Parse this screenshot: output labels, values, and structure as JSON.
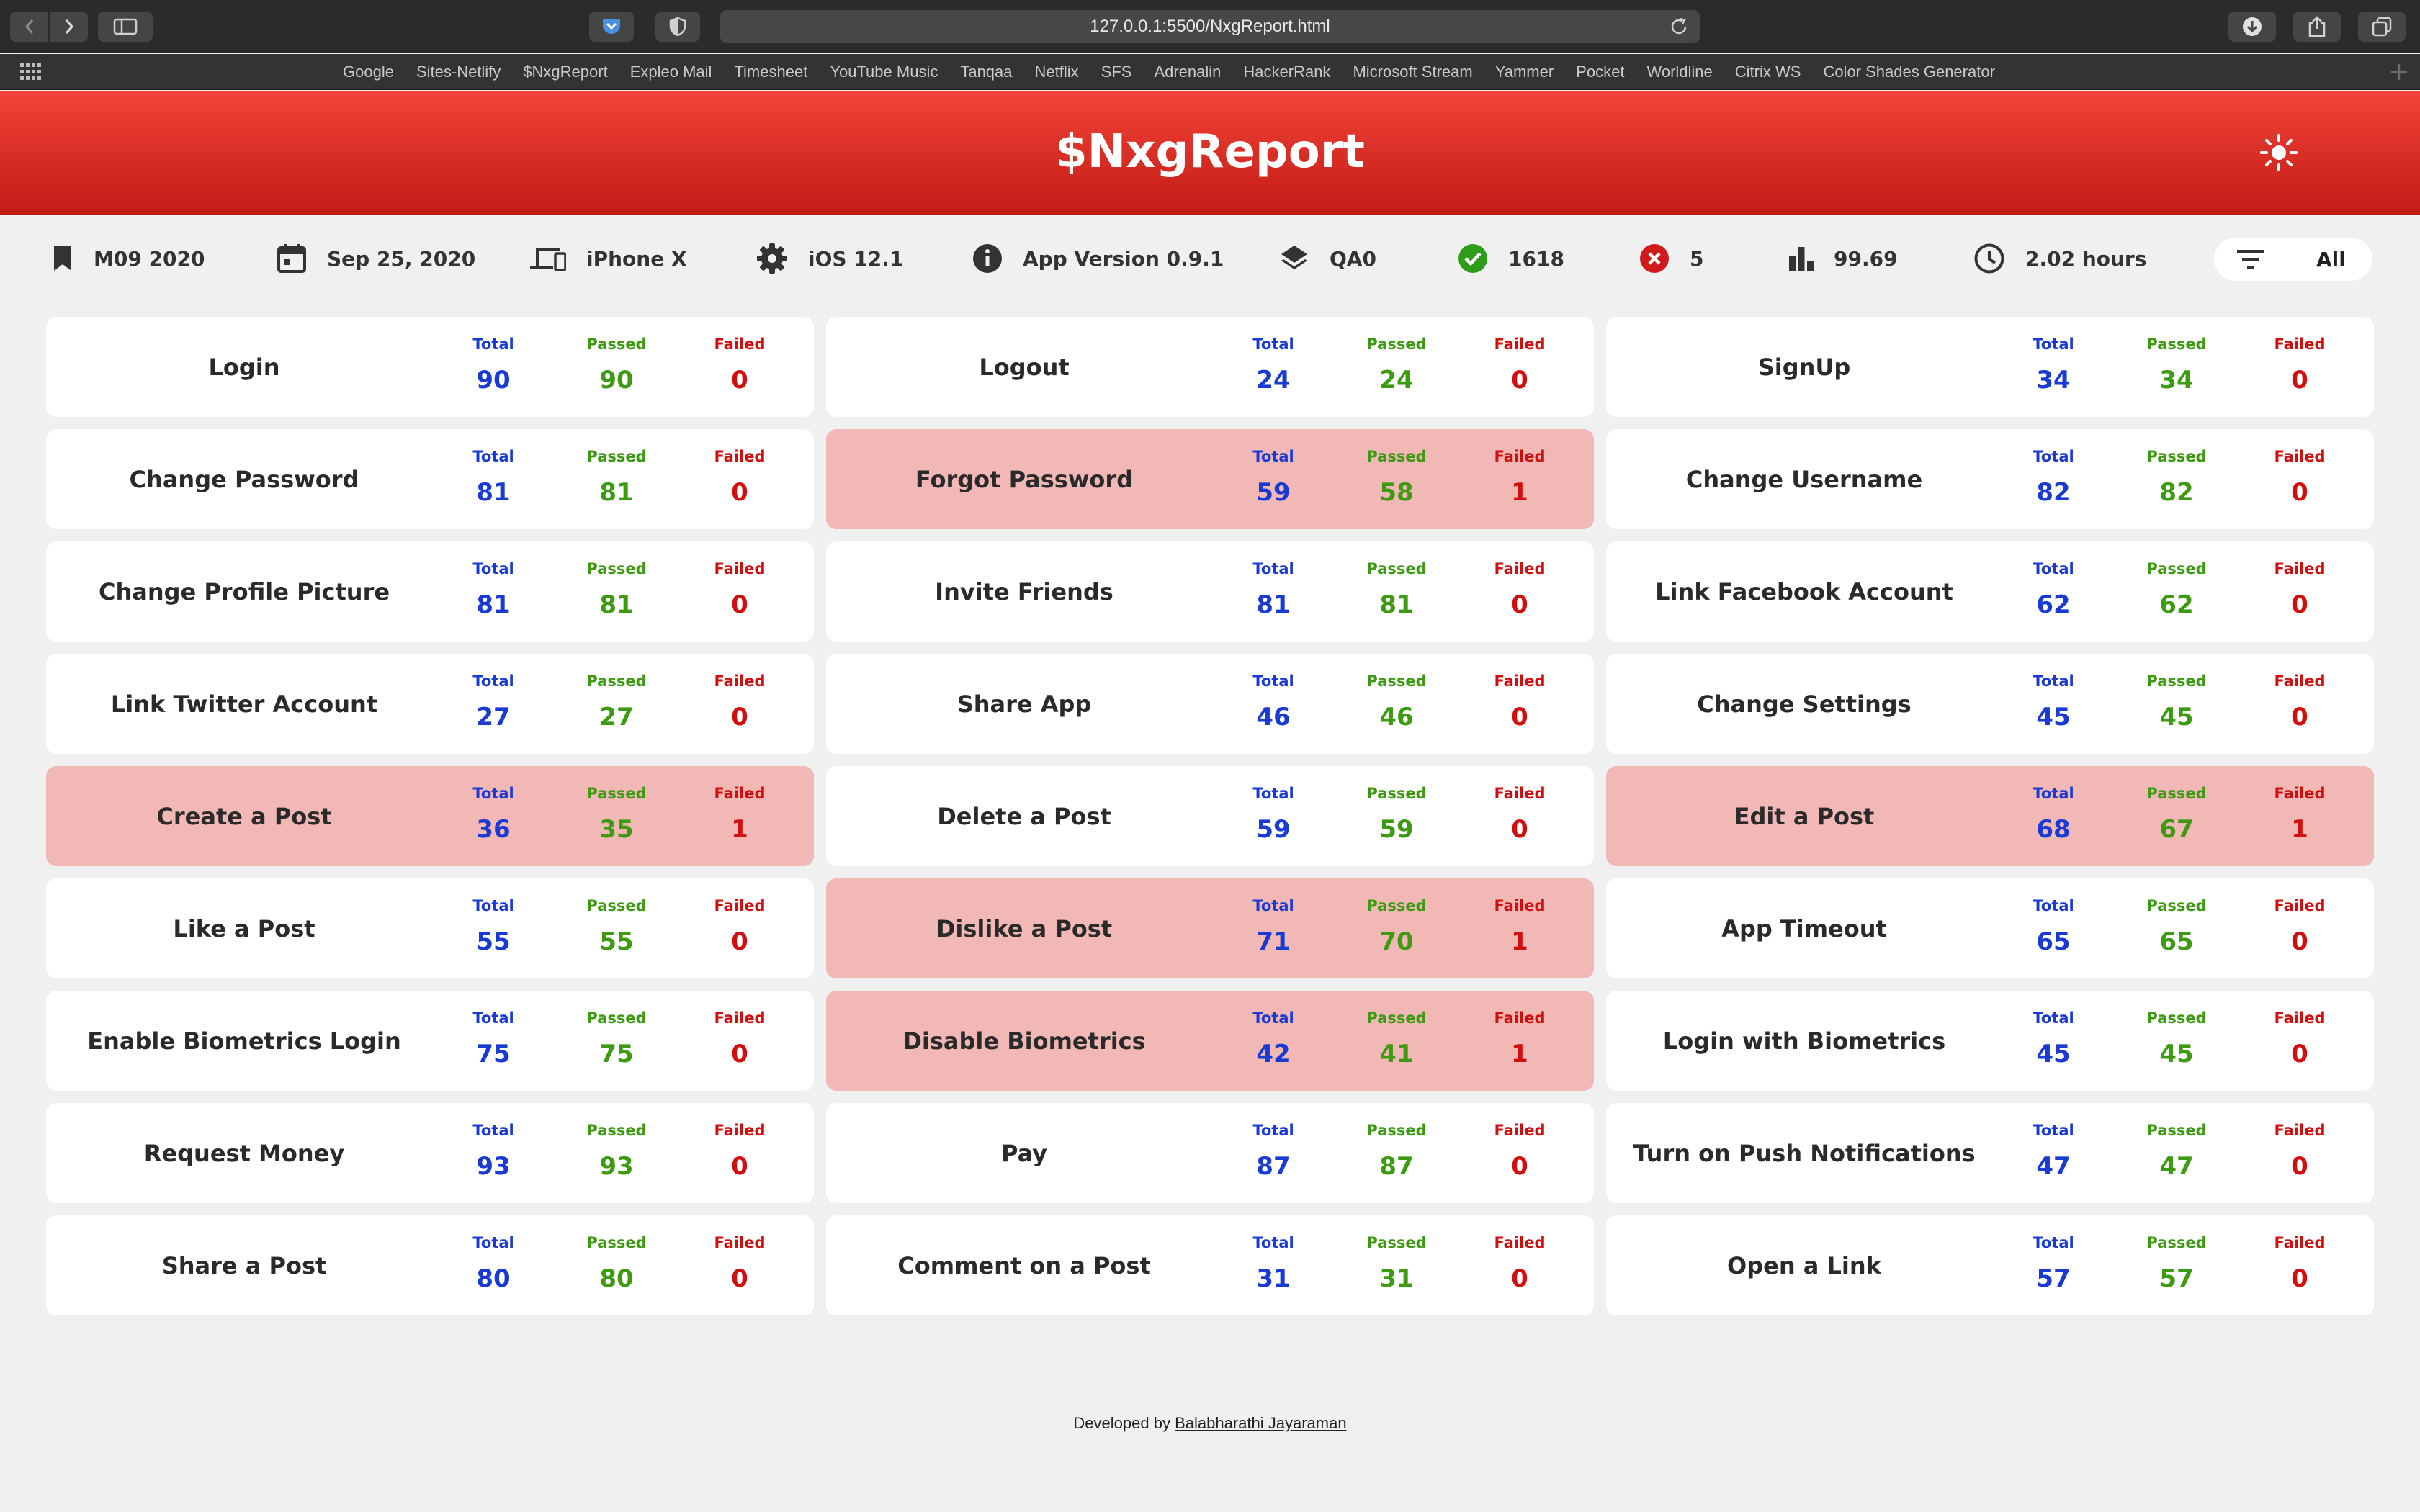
{
  "browser": {
    "url": "127.0.0.1:5500/NxgReport.html",
    "favorites": [
      "Google",
      "Sites-Netlify",
      "$NxgReport",
      "Expleo Mail",
      "Timesheet",
      "YouTube Music",
      "Tanqaa",
      "Netflix",
      "SFS",
      "Adrenalin",
      "HackerRank",
      "Microsoft Stream",
      "Yammer",
      "Pocket",
      "Worldline",
      "Citrix WS",
      "Color Shades Generator"
    ]
  },
  "header": {
    "title": "$NxgReport"
  },
  "info": {
    "release": "M09 2020",
    "date": "Sep 25, 2020",
    "device": "iPhone X",
    "os": "iOS 12.1",
    "app_version": "App Version 0.9.1",
    "environment": "QA0",
    "passed": "1618",
    "failed": "5",
    "pass_rate": "99.69",
    "duration": "2.02 hours",
    "filter": "All"
  },
  "labels": {
    "total": "Total",
    "passed": "Passed",
    "failed": "Failed"
  },
  "colors": {
    "header": "#d52b22",
    "total": "#1a3ad4",
    "passed": "#3d9b12",
    "failed": "#d10f0f",
    "failed_card": "#f2b8b6"
  },
  "features": [
    {
      "name": "Login",
      "total": "90",
      "passed": "90",
      "failed": "0"
    },
    {
      "name": "Logout",
      "total": "24",
      "passed": "24",
      "failed": "0"
    },
    {
      "name": "SignUp",
      "total": "34",
      "passed": "34",
      "failed": "0"
    },
    {
      "name": "Change Password",
      "total": "81",
      "passed": "81",
      "failed": "0"
    },
    {
      "name": "Forgot Password",
      "total": "59",
      "passed": "58",
      "failed": "1"
    },
    {
      "name": "Change Username",
      "total": "82",
      "passed": "82",
      "failed": "0"
    },
    {
      "name": "Change Profile Picture",
      "total": "81",
      "passed": "81",
      "failed": "0"
    },
    {
      "name": "Invite Friends",
      "total": "81",
      "passed": "81",
      "failed": "0"
    },
    {
      "name": "Link Facebook Account",
      "total": "62",
      "passed": "62",
      "failed": "0"
    },
    {
      "name": "Link Twitter Account",
      "total": "27",
      "passed": "27",
      "failed": "0"
    },
    {
      "name": "Share App",
      "total": "46",
      "passed": "46",
      "failed": "0"
    },
    {
      "name": "Change Settings",
      "total": "45",
      "passed": "45",
      "failed": "0"
    },
    {
      "name": "Create a Post",
      "total": "36",
      "passed": "35",
      "failed": "1"
    },
    {
      "name": "Delete a Post",
      "total": "59",
      "passed": "59",
      "failed": "0"
    },
    {
      "name": "Edit a Post",
      "total": "68",
      "passed": "67",
      "failed": "1"
    },
    {
      "name": "Like a Post",
      "total": "55",
      "passed": "55",
      "failed": "0"
    },
    {
      "name": "Dislike a Post",
      "total": "71",
      "passed": "70",
      "failed": "1"
    },
    {
      "name": "App Timeout",
      "total": "65",
      "passed": "65",
      "failed": "0"
    },
    {
      "name": "Enable Biometrics Login",
      "total": "75",
      "passed": "75",
      "failed": "0"
    },
    {
      "name": "Disable Biometrics",
      "total": "42",
      "passed": "41",
      "failed": "1"
    },
    {
      "name": "Login with Biometrics",
      "total": "45",
      "passed": "45",
      "failed": "0"
    },
    {
      "name": "Request Money",
      "total": "93",
      "passed": "93",
      "failed": "0"
    },
    {
      "name": "Pay",
      "total": "87",
      "passed": "87",
      "failed": "0"
    },
    {
      "name": "Turn on Push Notifications",
      "total": "47",
      "passed": "47",
      "failed": "0"
    },
    {
      "name": "Share a Post",
      "total": "80",
      "passed": "80",
      "failed": "0"
    },
    {
      "name": "Comment on a Post",
      "total": "31",
      "passed": "31",
      "failed": "0"
    },
    {
      "name": "Open a Link",
      "total": "57",
      "passed": "57",
      "failed": "0"
    }
  ],
  "footer": {
    "prefix": "Developed by",
    "author": "Balabharathi Jayaraman"
  }
}
